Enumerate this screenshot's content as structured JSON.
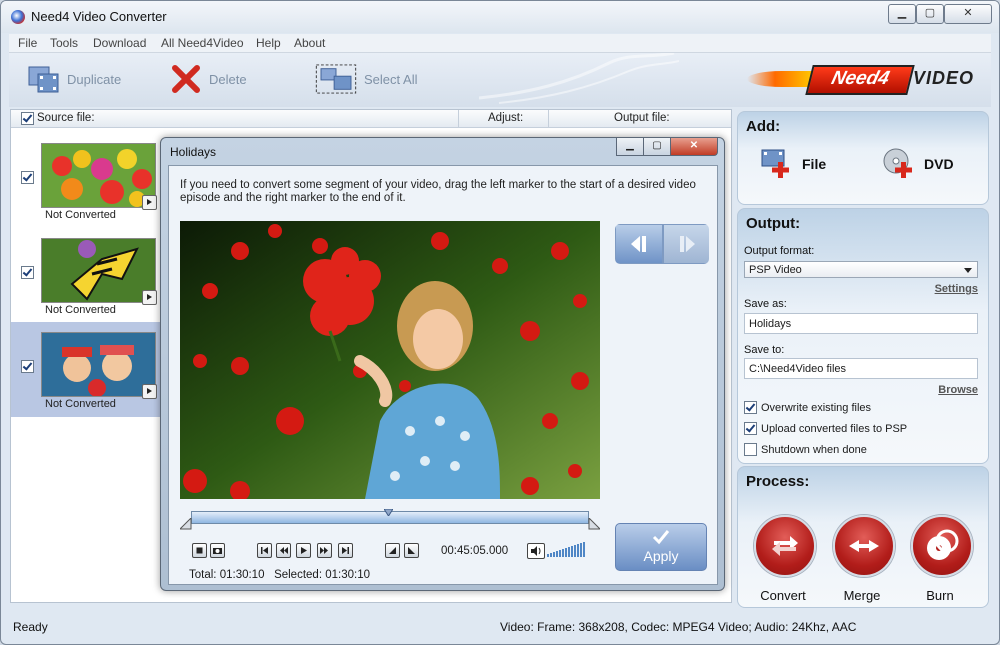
{
  "window": {
    "title": "Need4 Video Converter",
    "minimize": "▁",
    "maximize": "▢",
    "close": "✕"
  },
  "menu": [
    "File",
    "Tools",
    "Download",
    "All Need4Video",
    "Help",
    "About"
  ],
  "toolbar": {
    "duplicate": "Duplicate",
    "delete": "Delete",
    "select_all": "Select All"
  },
  "logo": {
    "brand": "Need4",
    "suffix": "VIDEO"
  },
  "list": {
    "headers": {
      "source": "Source file:",
      "adjust": "Adjust:",
      "output": "Output file:"
    },
    "items": [
      {
        "status": "Not Converted",
        "checked": true,
        "selected": false
      },
      {
        "status": "Not Converted",
        "checked": true,
        "selected": false
      },
      {
        "status": "Not Converted",
        "checked": true,
        "selected": true
      }
    ]
  },
  "dialog": {
    "title": "Holidays",
    "instructions": "If you need to convert some segment of your video, drag the left marker to the start of a desired video episode and the right marker to the end of it.",
    "time": "00:45:05.000",
    "total_label": "Total:",
    "total": "01:30:10",
    "selected_label": "Selected:",
    "selected": "01:30:10",
    "apply": "Apply"
  },
  "add": {
    "title": "Add:",
    "file": "File",
    "dvd": "DVD"
  },
  "output": {
    "title": "Output:",
    "format_label": "Output format:",
    "format_value": "PSP Video",
    "settings_link": "Settings",
    "save_as_label": "Save as:",
    "save_as_value": "Holidays",
    "save_to_label": "Save to:",
    "save_to_value": "C:\\Need4Video files",
    "browse_link": "Browse",
    "overwrite": "Overwrite existing files",
    "upload": "Upload converted files to PSP",
    "shutdown": "Shutdown when done",
    "overwrite_checked": true,
    "upload_checked": true,
    "shutdown_checked": false
  },
  "process": {
    "title": "Process:",
    "convert": "Convert",
    "merge": "Merge",
    "burn": "Burn"
  },
  "status": {
    "left": "Ready",
    "right": "Video: Frame: 368x208, Codec: MPEG4 Video; Audio: 24Khz, AAC"
  },
  "colors": {
    "accent": "#6f93c7",
    "process_red": "#b21d1a",
    "selection": "#b9c7e3"
  }
}
